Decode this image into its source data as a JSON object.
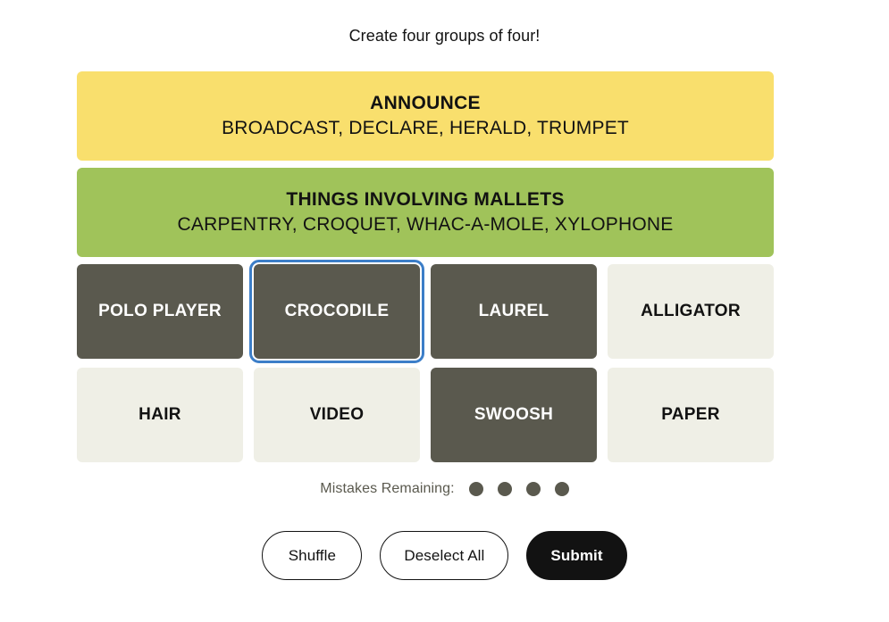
{
  "header": {
    "instruction": "Create four groups of four!"
  },
  "colors": {
    "page_background": "#ffffff",
    "tile_unselected": "#efefe6",
    "tile_selected": "#5a594e",
    "tile_text": "#121212",
    "tile_selected_text": "#ffffff",
    "focus_ring": "#3c7ec8",
    "category_yellow": "#f9df6d",
    "category_green": "#a0c35a",
    "mistakes_dot": "#5a594e",
    "submit_background": "#121212"
  },
  "solved_categories": [
    {
      "title": "ANNOUNCE",
      "members": "BROADCAST, DECLARE, HERALD, TRUMPET",
      "color": "#f9df6d",
      "difficulty": "yellow"
    },
    {
      "title": "THINGS INVOLVING MALLETS",
      "members": "CARPENTRY, CROQUET, WHAC-A-MOLE, XYLOPHONE",
      "color": "#a0c35a",
      "difficulty": "green"
    }
  ],
  "board_rows": [
    [
      {
        "label": "POLO PLAYER",
        "selected": true,
        "focused": false
      },
      {
        "label": "CROCODILE",
        "selected": true,
        "focused": true
      },
      {
        "label": "LAUREL",
        "selected": true,
        "focused": false
      },
      {
        "label": "ALLIGATOR",
        "selected": false,
        "focused": false
      }
    ],
    [
      {
        "label": "HAIR",
        "selected": false,
        "focused": false
      },
      {
        "label": "VIDEO",
        "selected": false,
        "focused": false
      },
      {
        "label": "SWOOSH",
        "selected": true,
        "focused": false
      },
      {
        "label": "PAPER",
        "selected": false,
        "focused": false
      }
    ]
  ],
  "mistakes": {
    "label": "Mistakes Remaining:",
    "remaining": 4,
    "dot_icon": "filled-circle-icon"
  },
  "controls": {
    "shuffle_label": "Shuffle",
    "deselect_label": "Deselect All",
    "submit_label": "Submit"
  }
}
